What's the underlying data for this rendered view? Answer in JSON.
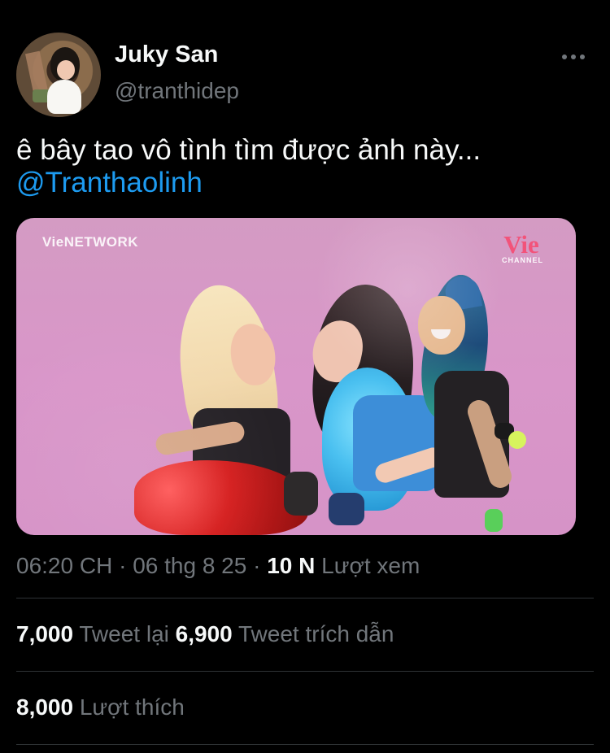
{
  "tweet": {
    "author": {
      "name": "Juky San",
      "handle": "@tranthidep"
    },
    "text": "ê bây tao vô tình tìm được ảnh này...",
    "mention": "@Tranthaolinh",
    "media": {
      "network_logo": "VieNETWORK",
      "channel_main": "Vie",
      "channel_sub": "CHANNEL"
    },
    "meta": {
      "time": "06:20 CH",
      "date": "06 thg 8 25",
      "views_count": "10 N",
      "views_label": "Lượt xem"
    },
    "stats": {
      "retweets_count": "7,000",
      "retweets_label": "Tweet lại",
      "quotes_count": "6,900",
      "quotes_label": "Tweet trích dẫn",
      "likes_count": "8,000",
      "likes_label": "Lượt thích"
    }
  },
  "icons": {
    "more": "more-horizontal-icon"
  }
}
